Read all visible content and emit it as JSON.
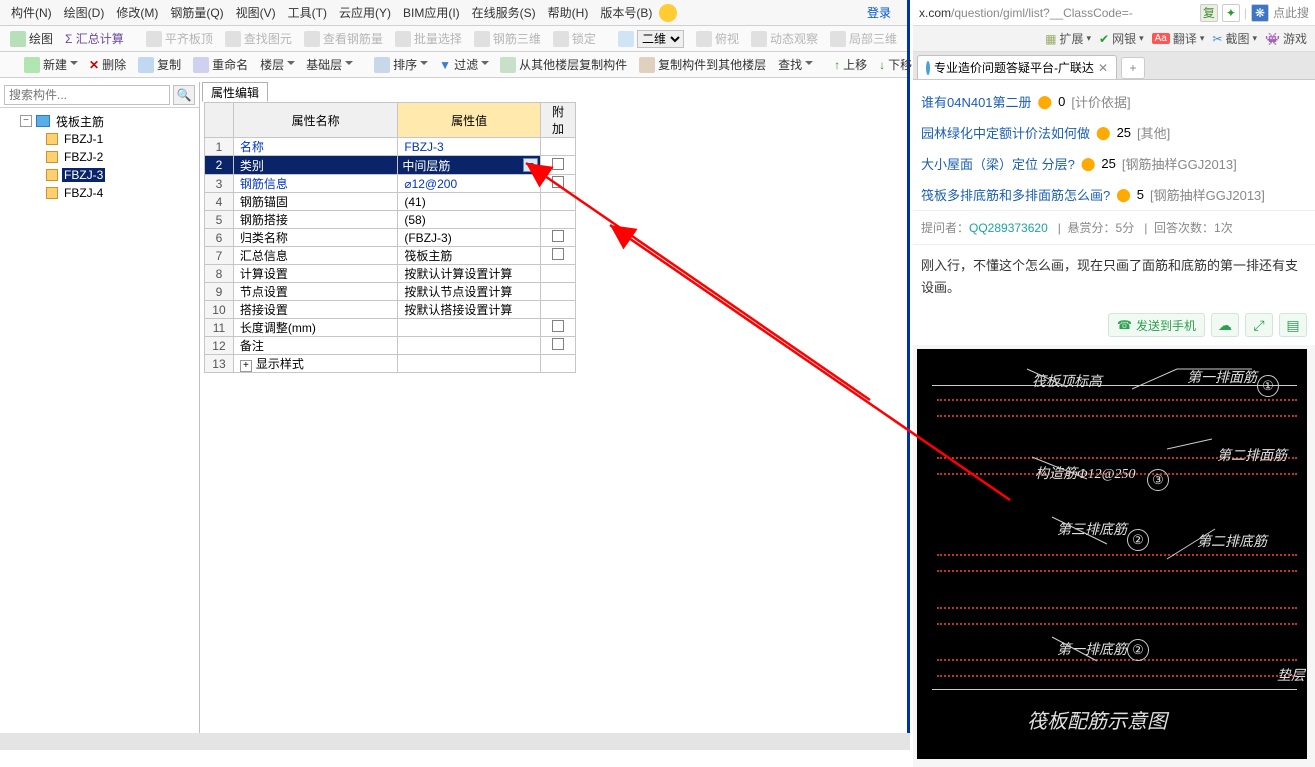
{
  "menubar": {
    "items": [
      "构件(N)",
      "绘图(D)",
      "修改(M)",
      "钢筋量(Q)",
      "视图(V)",
      "工具(T)",
      "云应用(Y)",
      "BIM应用(I)",
      "在线服务(S)",
      "帮助(H)",
      "版本号(B)"
    ],
    "login": "登录"
  },
  "toolbar1": {
    "t0": "绘图",
    "t1": "Σ 汇总计算",
    "t2": "平齐板顶",
    "t3": "查找图元",
    "t4": "查看钢筋量",
    "t5": "批量选择",
    "t6": "钢筋三维",
    "t7": "锁定",
    "t8": "二维",
    "t9": "俯视",
    "t10": "动态观察",
    "t11": "局部三维"
  },
  "toolbar2": {
    "t0": "新建",
    "t1": "删除",
    "t2": "复制",
    "t3": "重命名",
    "t4": "楼层",
    "t5": "基础层",
    "t6": "排序",
    "t7": "过滤",
    "t8": "从其他楼层复制构件",
    "t9": "复制构件到其他楼层",
    "t10": "查找",
    "t11": "上移",
    "t12": "下移"
  },
  "sidebar": {
    "search_placeholder": "搜索构件...",
    "root": "筏板主筋",
    "items": [
      "FBZJ-1",
      "FBZJ-2",
      "FBZJ-3",
      "FBZJ-4"
    ],
    "selected_index": 2
  },
  "props": {
    "tab": "属性编辑",
    "headers": {
      "name": "属性名称",
      "value": "属性值",
      "add": "附加"
    },
    "rows": [
      {
        "num": "1",
        "name": "名称",
        "val": "FBZJ-3",
        "blue": true,
        "chk": false
      },
      {
        "num": "2",
        "name": "类别",
        "val": "中间层筋",
        "blue": true,
        "chk": true,
        "selected": true
      },
      {
        "num": "3",
        "name": "钢筋信息",
        "val": "⌀12@200",
        "blue": true,
        "chk": true
      },
      {
        "num": "4",
        "name": "钢筋锚固",
        "val": "(41)",
        "chk": false
      },
      {
        "num": "5",
        "name": "钢筋搭接",
        "val": "(58)",
        "chk": false
      },
      {
        "num": "6",
        "name": "归类名称",
        "val": "(FBZJ-3)",
        "chk": true
      },
      {
        "num": "7",
        "name": "汇总信息",
        "val": "筏板主筋",
        "chk": true
      },
      {
        "num": "8",
        "name": "计算设置",
        "val": "按默认计算设置计算",
        "chk": false
      },
      {
        "num": "9",
        "name": "节点设置",
        "val": "按默认节点设置计算",
        "chk": false
      },
      {
        "num": "10",
        "name": "搭接设置",
        "val": "按默认搭接设置计算",
        "chk": false
      },
      {
        "num": "11",
        "name": "长度调整(mm)",
        "val": "",
        "chk": true
      },
      {
        "num": "12",
        "name": "备注",
        "val": "",
        "chk": true
      },
      {
        "num": "13",
        "name": "显示样式",
        "val": "",
        "expander": true
      }
    ]
  },
  "browser": {
    "url_pre": "x.com",
    "url_rest": "/question/giml/list?__ClassCode=-",
    "url_hint": "点此搜",
    "tb": {
      "ext": "扩展",
      "bank": "网银",
      "trans": "翻译",
      "cap": "截图",
      "game": "游戏"
    },
    "tab_title": "专业造价问题答疑平台-广联达",
    "qa": [
      {
        "title": "谁有04N401第二册",
        "coin": "0",
        "tag": "[计价依据]"
      },
      {
        "title": "园林绿化中定额计价法如何做",
        "coin": "25",
        "tag": "[其他]"
      },
      {
        "title": "大小屋面（梁）定位 分层?",
        "coin": "25",
        "tag": "[钢筋抽样GGJ2013]"
      },
      {
        "title": "筏板多排底筋和多排面筋怎么画?",
        "coin": "5",
        "tag": "[钢筋抽样GGJ2013]"
      }
    ],
    "meta": {
      "asker_label": "提问者：",
      "asker": "QQ289373620",
      "bounty": "悬赏分：5分",
      "answers": "回答次数：1次"
    },
    "desc1": "刚入行，不懂这个怎么画，现在只画了面筋和底筋的第一排还有支",
    "desc2": "设画。",
    "send": "发送到手机"
  },
  "diagram": {
    "labels": {
      "top": "筏板顶标高",
      "r1": "第一排面筋",
      "r2": "第二排面筋",
      "mid": "构造筋Φ12@250",
      "r3": "第三排底筋",
      "r4": "第二排底筋",
      "r5": "第一排底筋",
      "bed": "垫层",
      "title": "筏板配筋示意图"
    }
  }
}
